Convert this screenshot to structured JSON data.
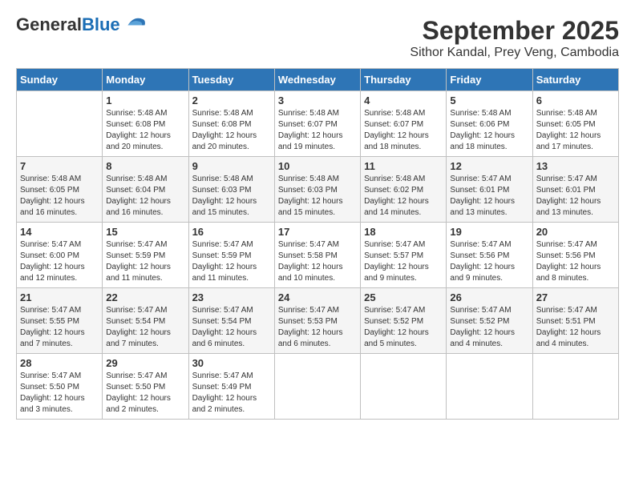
{
  "header": {
    "logo_line1": "General",
    "logo_line2": "Blue",
    "title": "September 2025",
    "subtitle": "Sithor Kandal, Prey Veng, Cambodia"
  },
  "calendar": {
    "headers": [
      "Sunday",
      "Monday",
      "Tuesday",
      "Wednesday",
      "Thursday",
      "Friday",
      "Saturday"
    ],
    "rows": [
      [
        {
          "day": "",
          "info": ""
        },
        {
          "day": "1",
          "info": "Sunrise: 5:48 AM\nSunset: 6:08 PM\nDaylight: 12 hours\nand 20 minutes."
        },
        {
          "day": "2",
          "info": "Sunrise: 5:48 AM\nSunset: 6:08 PM\nDaylight: 12 hours\nand 20 minutes."
        },
        {
          "day": "3",
          "info": "Sunrise: 5:48 AM\nSunset: 6:07 PM\nDaylight: 12 hours\nand 19 minutes."
        },
        {
          "day": "4",
          "info": "Sunrise: 5:48 AM\nSunset: 6:07 PM\nDaylight: 12 hours\nand 18 minutes."
        },
        {
          "day": "5",
          "info": "Sunrise: 5:48 AM\nSunset: 6:06 PM\nDaylight: 12 hours\nand 18 minutes."
        },
        {
          "day": "6",
          "info": "Sunrise: 5:48 AM\nSunset: 6:05 PM\nDaylight: 12 hours\nand 17 minutes."
        }
      ],
      [
        {
          "day": "7",
          "info": "Sunrise: 5:48 AM\nSunset: 6:05 PM\nDaylight: 12 hours\nand 16 minutes."
        },
        {
          "day": "8",
          "info": "Sunrise: 5:48 AM\nSunset: 6:04 PM\nDaylight: 12 hours\nand 16 minutes."
        },
        {
          "day": "9",
          "info": "Sunrise: 5:48 AM\nSunset: 6:03 PM\nDaylight: 12 hours\nand 15 minutes."
        },
        {
          "day": "10",
          "info": "Sunrise: 5:48 AM\nSunset: 6:03 PM\nDaylight: 12 hours\nand 15 minutes."
        },
        {
          "day": "11",
          "info": "Sunrise: 5:48 AM\nSunset: 6:02 PM\nDaylight: 12 hours\nand 14 minutes."
        },
        {
          "day": "12",
          "info": "Sunrise: 5:47 AM\nSunset: 6:01 PM\nDaylight: 12 hours\nand 13 minutes."
        },
        {
          "day": "13",
          "info": "Sunrise: 5:47 AM\nSunset: 6:01 PM\nDaylight: 12 hours\nand 13 minutes."
        }
      ],
      [
        {
          "day": "14",
          "info": "Sunrise: 5:47 AM\nSunset: 6:00 PM\nDaylight: 12 hours\nand 12 minutes."
        },
        {
          "day": "15",
          "info": "Sunrise: 5:47 AM\nSunset: 5:59 PM\nDaylight: 12 hours\nand 11 minutes."
        },
        {
          "day": "16",
          "info": "Sunrise: 5:47 AM\nSunset: 5:59 PM\nDaylight: 12 hours\nand 11 minutes."
        },
        {
          "day": "17",
          "info": "Sunrise: 5:47 AM\nSunset: 5:58 PM\nDaylight: 12 hours\nand 10 minutes."
        },
        {
          "day": "18",
          "info": "Sunrise: 5:47 AM\nSunset: 5:57 PM\nDaylight: 12 hours\nand 9 minutes."
        },
        {
          "day": "19",
          "info": "Sunrise: 5:47 AM\nSunset: 5:56 PM\nDaylight: 12 hours\nand 9 minutes."
        },
        {
          "day": "20",
          "info": "Sunrise: 5:47 AM\nSunset: 5:56 PM\nDaylight: 12 hours\nand 8 minutes."
        }
      ],
      [
        {
          "day": "21",
          "info": "Sunrise: 5:47 AM\nSunset: 5:55 PM\nDaylight: 12 hours\nand 7 minutes."
        },
        {
          "day": "22",
          "info": "Sunrise: 5:47 AM\nSunset: 5:54 PM\nDaylight: 12 hours\nand 7 minutes."
        },
        {
          "day": "23",
          "info": "Sunrise: 5:47 AM\nSunset: 5:54 PM\nDaylight: 12 hours\nand 6 minutes."
        },
        {
          "day": "24",
          "info": "Sunrise: 5:47 AM\nSunset: 5:53 PM\nDaylight: 12 hours\nand 6 minutes."
        },
        {
          "day": "25",
          "info": "Sunrise: 5:47 AM\nSunset: 5:52 PM\nDaylight: 12 hours\nand 5 minutes."
        },
        {
          "day": "26",
          "info": "Sunrise: 5:47 AM\nSunset: 5:52 PM\nDaylight: 12 hours\nand 4 minutes."
        },
        {
          "day": "27",
          "info": "Sunrise: 5:47 AM\nSunset: 5:51 PM\nDaylight: 12 hours\nand 4 minutes."
        }
      ],
      [
        {
          "day": "28",
          "info": "Sunrise: 5:47 AM\nSunset: 5:50 PM\nDaylight: 12 hours\nand 3 minutes."
        },
        {
          "day": "29",
          "info": "Sunrise: 5:47 AM\nSunset: 5:50 PM\nDaylight: 12 hours\nand 2 minutes."
        },
        {
          "day": "30",
          "info": "Sunrise: 5:47 AM\nSunset: 5:49 PM\nDaylight: 12 hours\nand 2 minutes."
        },
        {
          "day": "",
          "info": ""
        },
        {
          "day": "",
          "info": ""
        },
        {
          "day": "",
          "info": ""
        },
        {
          "day": "",
          "info": ""
        }
      ]
    ]
  }
}
